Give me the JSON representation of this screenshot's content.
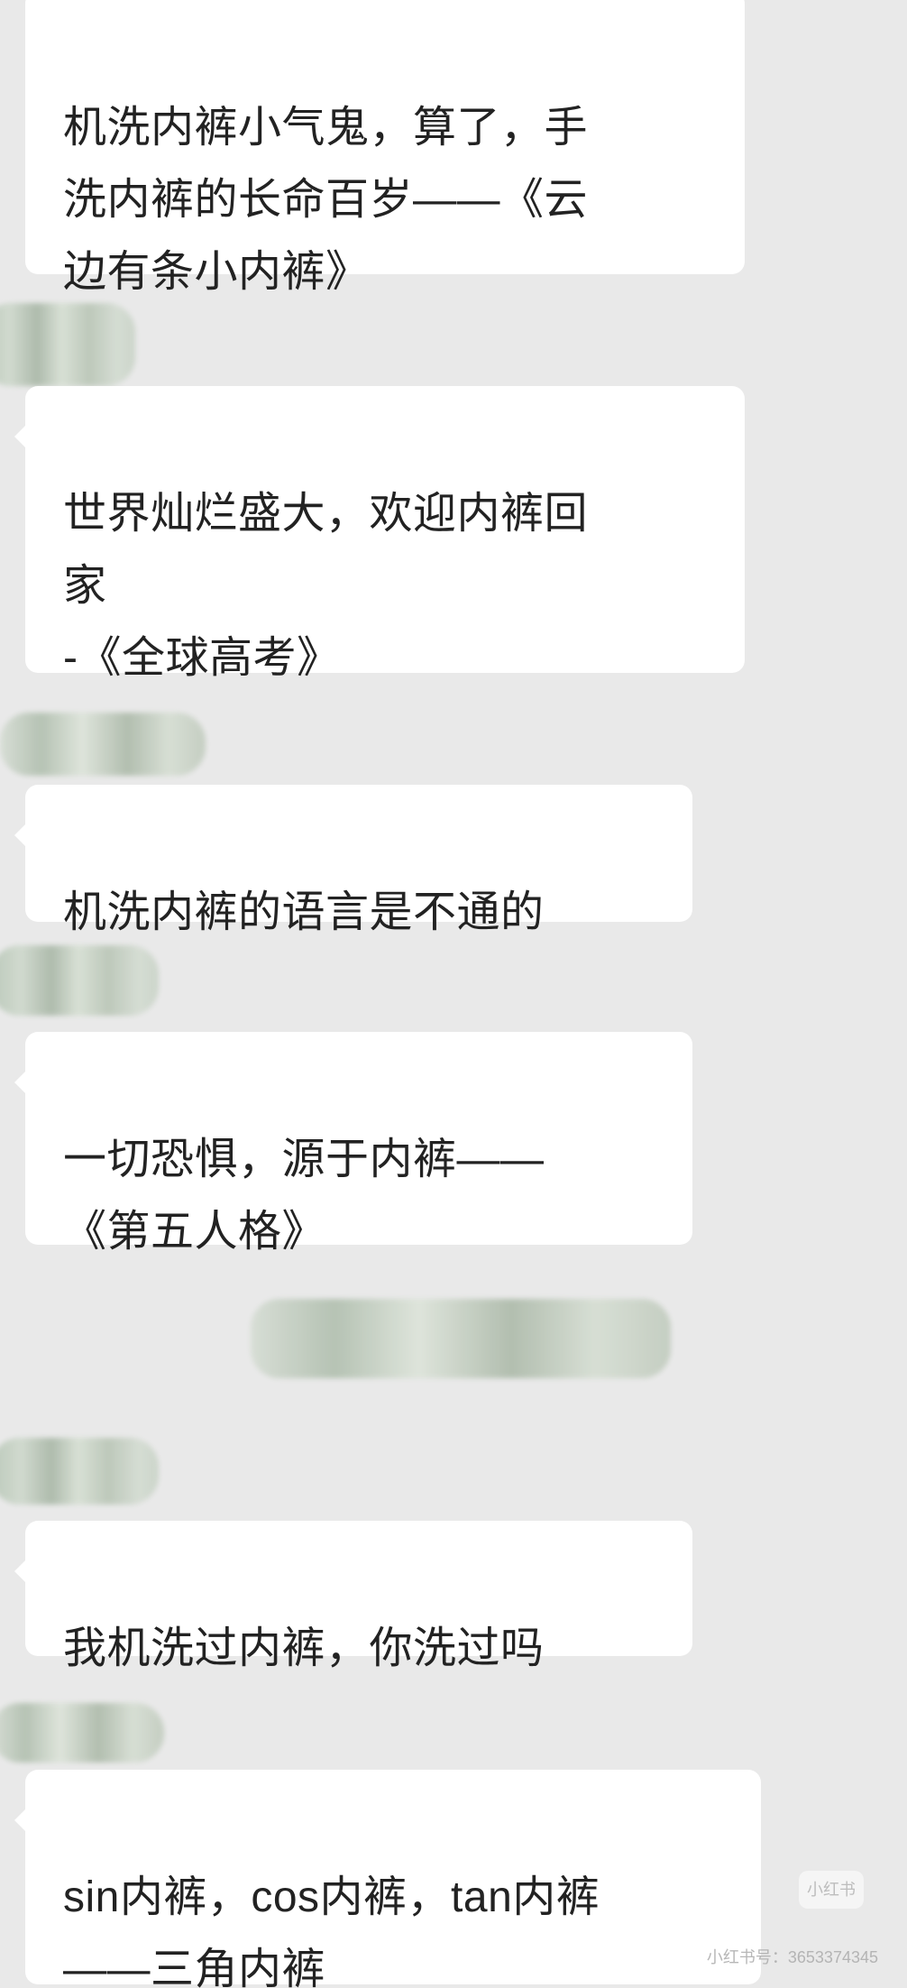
{
  "messages": [
    {
      "text": "机洗内裤小气鬼，算了，手\n洗内裤的长命百岁——《云\n边有条小内裤》"
    },
    {
      "text": "世界灿烂盛大，欢迎内裤回\n家\n-《全球高考》"
    },
    {
      "text": "机洗内裤的语言是不通的"
    },
    {
      "text": "一切恐惧，源于内裤——\n《第五人格》"
    },
    {
      "text": "我机洗过内裤，你洗过吗"
    },
    {
      "text": "sin内裤，cos内裤，tan内裤\n——三角内裤"
    }
  ],
  "watermark": {
    "logo_text": "小红书",
    "id_text": "小红书号：3653374345"
  }
}
